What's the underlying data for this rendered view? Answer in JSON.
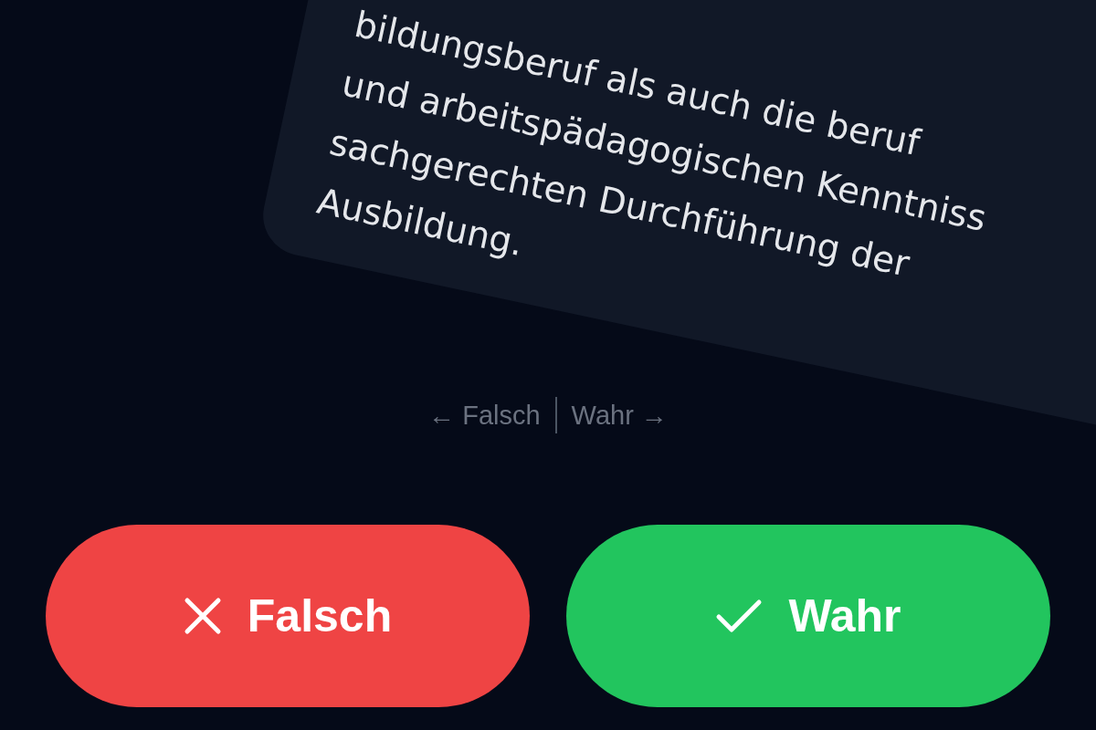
{
  "card": {
    "lines": [
      "bildungsberuf als auch die beruf",
      "und arbeitspädagogischen Kenntniss",
      "sachgerechten Durchführung der",
      "Ausbildung."
    ]
  },
  "swipe_hint": {
    "left": "← Falsch",
    "right": "Wahr →"
  },
  "buttons": [
    {
      "kind": "false",
      "label": "Falsch"
    },
    {
      "kind": "true",
      "label": "Wahr"
    }
  ]
}
